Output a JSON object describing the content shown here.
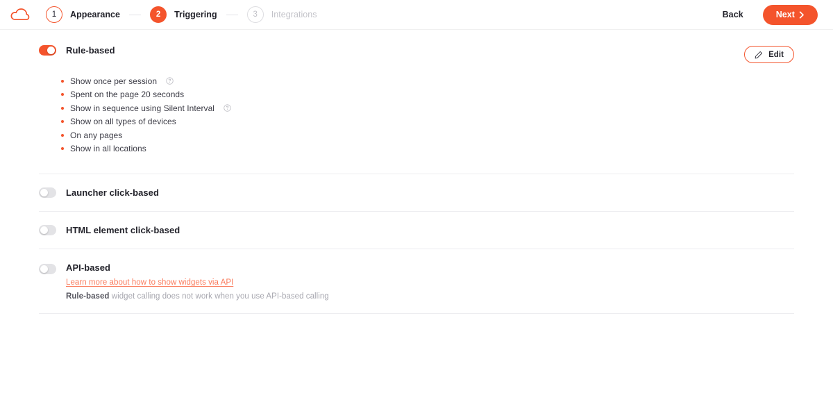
{
  "brand": {
    "logo_icon": "cloud-outline-icon",
    "accent_color": "#f4542c",
    "link_color": "#fa7b5c"
  },
  "header": {
    "steps": [
      {
        "number": "1",
        "label": "Appearance",
        "state": "done"
      },
      {
        "number": "2",
        "label": "Triggering",
        "state": "active"
      },
      {
        "number": "3",
        "label": "Integrations",
        "state": "todo"
      }
    ],
    "back_label": "Back",
    "next_label": "Next",
    "next_icon": "chevron-right-icon"
  },
  "sections": [
    {
      "id": "rule-based",
      "title": "Rule-based",
      "toggle_on": true,
      "edit_label": "Edit",
      "edit_icon": "pencil-icon",
      "rules": [
        {
          "text": "Show once per session",
          "help": true
        },
        {
          "text": "Spent on the page 20 seconds",
          "help": false
        },
        {
          "text": "Show in sequence using Silent Interval",
          "help": true
        },
        {
          "text": "Show on all types of devices",
          "help": false
        },
        {
          "text": "On any pages",
          "help": false
        },
        {
          "text": "Show in all locations",
          "help": false
        }
      ]
    },
    {
      "id": "launcher-click-based",
      "title": "Launcher click-based",
      "toggle_on": false
    },
    {
      "id": "html-element-click-based",
      "title": "HTML element click-based",
      "toggle_on": false
    },
    {
      "id": "api-based",
      "title": "API-based",
      "toggle_on": false,
      "link_text": "Learn more about how to show widgets via API",
      "note_strong": "Rule-based",
      "note_rest": " widget calling does not work when you use API-based calling"
    }
  ]
}
